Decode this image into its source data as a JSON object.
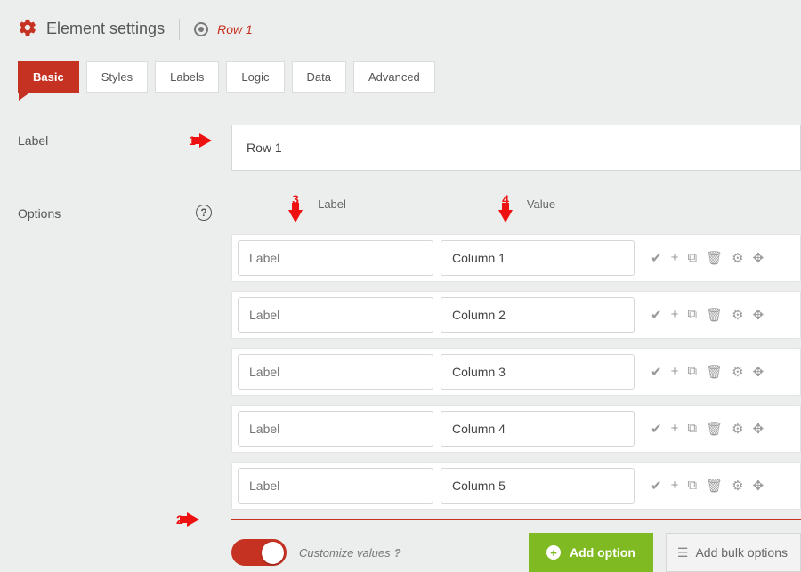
{
  "header": {
    "title": "Element settings",
    "breadcrumb": "Row 1"
  },
  "tabs": [
    {
      "label": "Basic",
      "active": true
    },
    {
      "label": "Styles",
      "active": false
    },
    {
      "label": "Labels",
      "active": false
    },
    {
      "label": "Logic",
      "active": false
    },
    {
      "label": "Data",
      "active": false
    },
    {
      "label": "Advanced",
      "active": false
    }
  ],
  "form": {
    "label_field_name": "Label",
    "label_value": "Row 1",
    "options_field_name": "Options",
    "option_header_label": "Label",
    "option_header_value": "Value",
    "option_label_placeholder": "Label",
    "options": [
      {
        "value": "Column 1"
      },
      {
        "value": "Column 2"
      },
      {
        "value": "Column 3"
      },
      {
        "value": "Column 4"
      },
      {
        "value": "Column 5"
      }
    ]
  },
  "footer": {
    "customize_label": "Customize values",
    "help_glyph": "?",
    "add_option_label": "Add option",
    "add_bulk_label": "Add bulk options"
  },
  "annotations": {
    "a1": "1",
    "a2": "2",
    "a3": "3",
    "a4": "4"
  },
  "icons": {
    "check": "✔",
    "plus": "+",
    "copy": "⧉",
    "trash": "🗑",
    "gear": "✿",
    "move": "✥",
    "bulk": "☰"
  }
}
